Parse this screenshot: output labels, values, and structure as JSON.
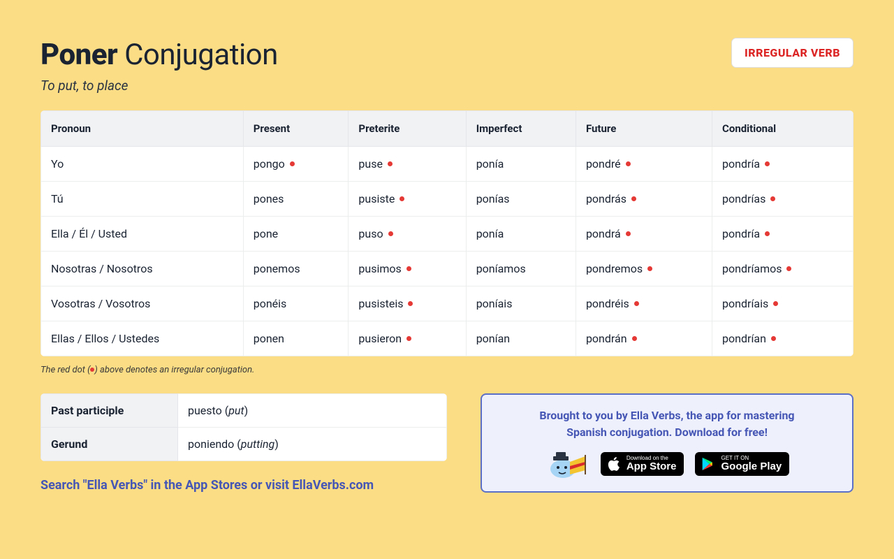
{
  "header": {
    "verb": "Poner",
    "suffix": "Conjugation",
    "badge": "IRREGULAR VERB",
    "subtitle": "To put, to place"
  },
  "columns": [
    "Pronoun",
    "Present",
    "Preterite",
    "Imperfect",
    "Future",
    "Conditional"
  ],
  "rows": [
    {
      "pronoun": "Yo",
      "present": {
        "t": "pongo",
        "i": true
      },
      "preterite": {
        "t": "puse",
        "i": true
      },
      "imperfect": {
        "t": "ponía",
        "i": false
      },
      "future": {
        "t": "pondré",
        "i": true
      },
      "conditional": {
        "t": "pondría",
        "i": true
      }
    },
    {
      "pronoun": "Tú",
      "present": {
        "t": "pones",
        "i": false
      },
      "preterite": {
        "t": "pusiste",
        "i": true
      },
      "imperfect": {
        "t": "ponías",
        "i": false
      },
      "future": {
        "t": "pondrás",
        "i": true
      },
      "conditional": {
        "t": "pondrías",
        "i": true
      }
    },
    {
      "pronoun": "Ella / Él / Usted",
      "present": {
        "t": "pone",
        "i": false
      },
      "preterite": {
        "t": "puso",
        "i": true
      },
      "imperfect": {
        "t": "ponía",
        "i": false
      },
      "future": {
        "t": "pondrá",
        "i": true
      },
      "conditional": {
        "t": "pondría",
        "i": true
      }
    },
    {
      "pronoun": "Nosotras / Nosotros",
      "present": {
        "t": "ponemos",
        "i": false
      },
      "preterite": {
        "t": "pusimos",
        "i": true
      },
      "imperfect": {
        "t": "poníamos",
        "i": false
      },
      "future": {
        "t": "pondremos",
        "i": true
      },
      "conditional": {
        "t": "pondríamos",
        "i": true
      }
    },
    {
      "pronoun": "Vosotras / Vosotros",
      "present": {
        "t": "ponéis",
        "i": false
      },
      "preterite": {
        "t": "pusisteis",
        "i": true
      },
      "imperfect": {
        "t": "poníais",
        "i": false
      },
      "future": {
        "t": "pondréis",
        "i": true
      },
      "conditional": {
        "t": "pondríais",
        "i": true
      }
    },
    {
      "pronoun": "Ellas / Ellos / Ustedes",
      "present": {
        "t": "ponen",
        "i": false
      },
      "preterite": {
        "t": "pusieron",
        "i": true
      },
      "imperfect": {
        "t": "ponían",
        "i": false
      },
      "future": {
        "t": "pondrán",
        "i": true
      },
      "conditional": {
        "t": "pondrían",
        "i": true
      }
    }
  ],
  "footnote_pre": "The red dot (",
  "footnote_post": ") above denotes an irregular conjugation.",
  "forms": {
    "past_label": "Past participle",
    "past_value": "puesto",
    "past_trans": "put",
    "gerund_label": "Gerund",
    "gerund_value": "poniendo",
    "gerund_trans": "putting"
  },
  "promo": {
    "line1": "Brought to you by Ella Verbs, the app for mastering",
    "line2": "Spanish conjugation. Download for free!",
    "appstore_small": "Download on the",
    "appstore_big": "App Store",
    "play_small": "GET IT ON",
    "play_big": "Google Play"
  },
  "search_line": "Search \"Ella Verbs\" in the App Stores or visit EllaVerbs.com"
}
